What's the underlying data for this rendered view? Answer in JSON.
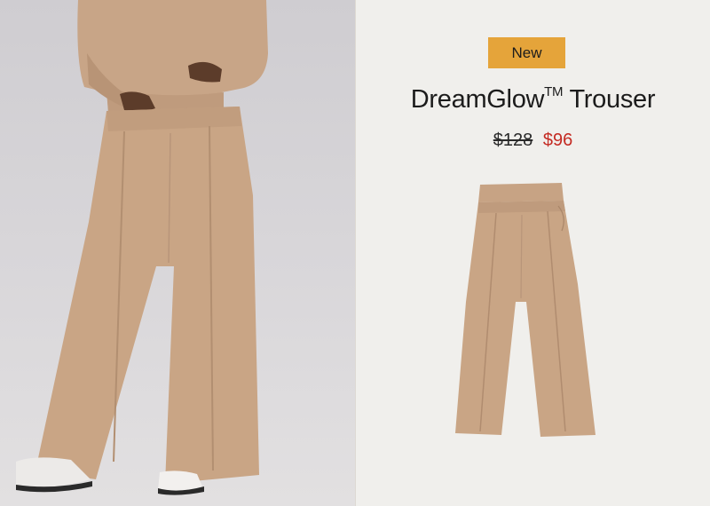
{
  "product": {
    "badge": "New",
    "name": "DreamGlow",
    "trademark": "TM",
    "name_suffix": " Trouser",
    "original_price": "$128",
    "sale_price": "$96"
  },
  "colors": {
    "badge": "#e5a43a",
    "sale_price": "#c42a22",
    "fabric": "#c9a585",
    "background": "#efeeeb"
  }
}
